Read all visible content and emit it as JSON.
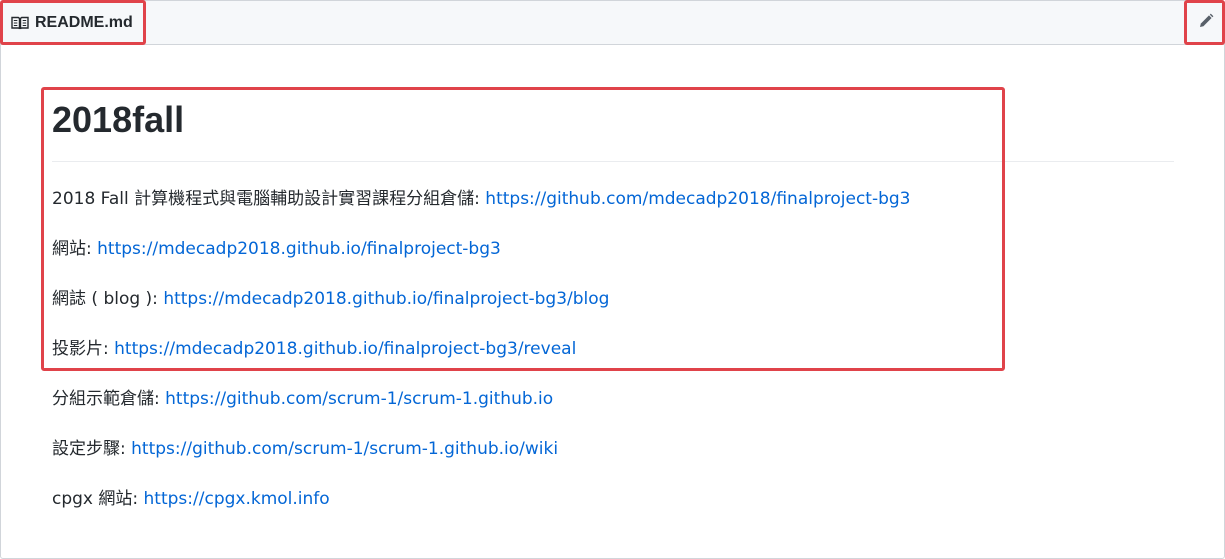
{
  "header": {
    "filename": "README.md",
    "icon": "book-icon",
    "edit_icon": "pencil-icon"
  },
  "article": {
    "title": "2018fall",
    "paragraphs": [
      {
        "label": "2018 Fall 計算機程式與電腦輔助設計實習課程分組倉儲: ",
        "link": "https://github.com/mdecadp2018/finalproject-bg3"
      },
      {
        "label": "網站: ",
        "link": "https://mdecadp2018.github.io/finalproject-bg3"
      },
      {
        "label": "網誌 ( blog ): ",
        "link": "https://mdecadp2018.github.io/finalproject-bg3/blog"
      },
      {
        "label": "投影片: ",
        "link": "https://mdecadp2018.github.io/finalproject-bg3/reveal"
      },
      {
        "label": "分組示範倉儲: ",
        "link": "https://github.com/scrum-1/scrum-1.github.io"
      },
      {
        "label": "設定步驟: ",
        "link": "https://github.com/scrum-1/scrum-1.github.io/wiki"
      },
      {
        "label": "cpgx 網站: ",
        "link": "https://cpgx.kmol.info"
      }
    ]
  },
  "colors": {
    "link": "#0366d6",
    "highlight": "#e0434a"
  }
}
